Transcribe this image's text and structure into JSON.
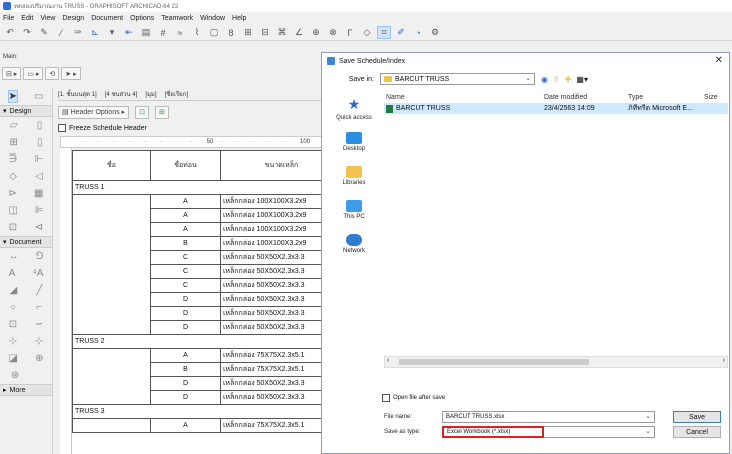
{
  "app": {
    "title": "ทดลองปริมาณงาน TRUSS - GRAPHISOFT ARCHICAD-64 22",
    "menu": [
      "File",
      "Edit",
      "View",
      "Design",
      "Document",
      "Options",
      "Teamwork",
      "Window",
      "Help"
    ],
    "main_label": "Main:"
  },
  "toolbox": {
    "design_label": "Design",
    "document_label": "Document",
    "more_label": "More"
  },
  "schedule": {
    "tabs": [
      "[1. ชั้นบนสุด 1]",
      "[4 ชนส่วน 4]",
      "[มุม]",
      "[ชื่อเรียก]"
    ],
    "header_options_label": "Header Options",
    "freeze_label": "Freeze Schedule Header",
    "ruler_50": "50",
    "ruler_100": "100",
    "col_headers": [
      "ชื่อ",
      "ชื่อท่อน",
      "ขนาดเหล็ก"
    ],
    "groups": [
      {
        "name": "TRUSS 1",
        "rows": [
          [
            "A",
            "เหล็กกล่อง 100X100X3.2x9"
          ],
          [
            "A",
            "เหล็กกล่อง 100X100X3.2x9"
          ],
          [
            "A",
            "เหล็กกล่อง 100X100X3.2x9"
          ],
          [
            "B",
            "เหล็กกล่อง 100X100X3.2x9"
          ],
          [
            "C",
            "เหล็กกล่อง 50X50X2.3x3.3"
          ],
          [
            "C",
            "เหล็กกล่อง 50X50X2.3x3.3"
          ],
          [
            "C",
            "เหล็กกล่อง 50X50X2.3x3.3"
          ],
          [
            "D",
            "เหล็กกล่อง 50X50X2.3x3.3"
          ],
          [
            "D",
            "เหล็กกล่อง 50X50X2.3x3.3"
          ],
          [
            "D",
            "เหล็กกล่อง 50X50X2.3x3.3"
          ]
        ]
      },
      {
        "name": "TRUSS 2",
        "rows": [
          [
            "A",
            "เหล็กกล่อง 75X75X2.3x5.1"
          ],
          [
            "B",
            "เหล็กกล่อง 75X75X2.3x5.1"
          ],
          [
            "D",
            "เหล็กกล่อง 50X50X2.3x3.3"
          ],
          [
            "D",
            "เหล็กกล่อง 50X50X2.3x3.3"
          ]
        ]
      },
      {
        "name": "TRUSS 3",
        "rows": [
          [
            "A",
            "เหล็กกล่อง 75X75X2.3x5.1"
          ]
        ]
      }
    ]
  },
  "dialog": {
    "title": "Save Schedule/Index",
    "save_in_label": "Save in:",
    "save_in_value": "BARCUT TRUSS",
    "places": [
      "Quick access",
      "Desktop",
      "Libraries",
      "This PC",
      "Network"
    ],
    "columns": {
      "name": "Name",
      "date": "Date modified",
      "type": "Type",
      "size": "Size"
    },
    "file": {
      "name": "BARCUT TRUSS",
      "date": "23/4/2563 14:09",
      "type": "ภิทีทรีต Microsoft E..."
    },
    "open_after_label": "Open file after save",
    "file_name_label": "File name:",
    "file_name_value": "BARCUT TRUSS.xlsx",
    "save_as_label": "Save as type:",
    "save_as_value": "Excel Workbook (*.xlsx)",
    "save_button": "Save",
    "cancel_button": "Cancel",
    "highlight_color": "#e02020",
    "selected_row_color": "#cde8ff"
  }
}
